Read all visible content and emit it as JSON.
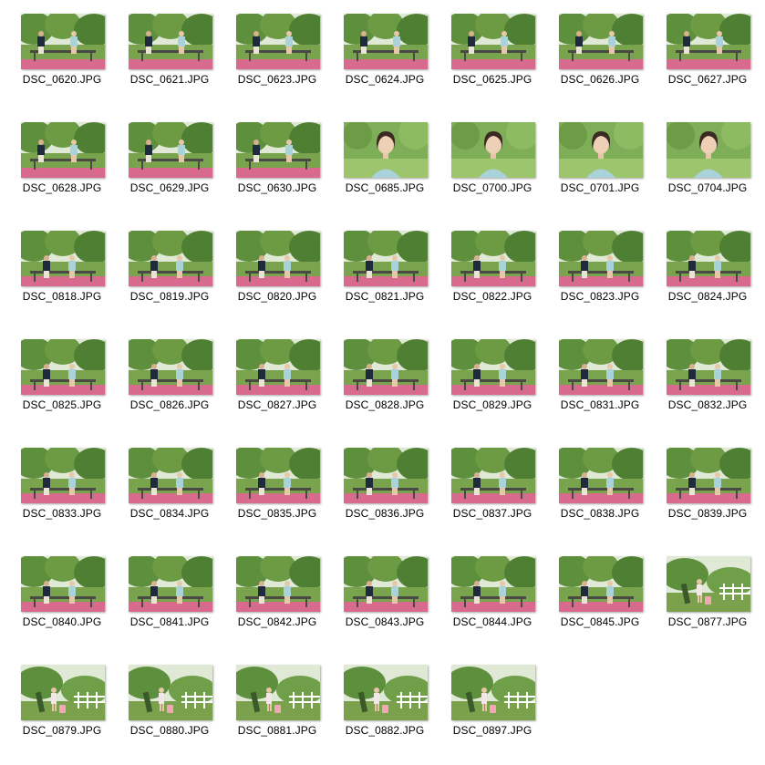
{
  "explorer": {
    "selected_index": 47,
    "files": [
      {
        "name": "DSC_0620.JPG",
        "scene": "couple"
      },
      {
        "name": "DSC_0621.JPG",
        "scene": "couple"
      },
      {
        "name": "DSC_0623.JPG",
        "scene": "couple"
      },
      {
        "name": "DSC_0624.JPG",
        "scene": "couple"
      },
      {
        "name": "DSC_0625.JPG",
        "scene": "couple"
      },
      {
        "name": "DSC_0626.JPG",
        "scene": "couple"
      },
      {
        "name": "DSC_0627.JPG",
        "scene": "couple"
      },
      {
        "name": "DSC_0628.JPG",
        "scene": "couple"
      },
      {
        "name": "DSC_0629.JPG",
        "scene": "couple"
      },
      {
        "name": "DSC_0630.JPG",
        "scene": "couple"
      },
      {
        "name": "DSC_0685.JPG",
        "scene": "portrait"
      },
      {
        "name": "DSC_0700.JPG",
        "scene": "portrait"
      },
      {
        "name": "DSC_0701.JPG",
        "scene": "portrait"
      },
      {
        "name": "DSC_0704.JPG",
        "scene": "portrait"
      },
      {
        "name": "DSC_0818.JPG",
        "scene": "bench"
      },
      {
        "name": "DSC_0819.JPG",
        "scene": "bench"
      },
      {
        "name": "DSC_0820.JPG",
        "scene": "bench"
      },
      {
        "name": "DSC_0821.JPG",
        "scene": "bench"
      },
      {
        "name": "DSC_0822.JPG",
        "scene": "bench"
      },
      {
        "name": "DSC_0823.JPG",
        "scene": "bench"
      },
      {
        "name": "DSC_0824.JPG",
        "scene": "bench"
      },
      {
        "name": "DSC_0825.JPG",
        "scene": "park"
      },
      {
        "name": "DSC_0826.JPG",
        "scene": "park"
      },
      {
        "name": "DSC_0827.JPG",
        "scene": "park"
      },
      {
        "name": "DSC_0828.JPG",
        "scene": "park"
      },
      {
        "name": "DSC_0829.JPG",
        "scene": "park"
      },
      {
        "name": "DSC_0831.JPG",
        "scene": "park"
      },
      {
        "name": "DSC_0832.JPG",
        "scene": "park"
      },
      {
        "name": "DSC_0833.JPG",
        "scene": "park"
      },
      {
        "name": "DSC_0834.JPG",
        "scene": "park"
      },
      {
        "name": "DSC_0835.JPG",
        "scene": "park"
      },
      {
        "name": "DSC_0836.JPG",
        "scene": "park"
      },
      {
        "name": "DSC_0837.JPG",
        "scene": "park"
      },
      {
        "name": "DSC_0838.JPG",
        "scene": "park"
      },
      {
        "name": "DSC_0839.JPG",
        "scene": "park"
      },
      {
        "name": "DSC_0840.JPG",
        "scene": "park"
      },
      {
        "name": "DSC_0841.JPG",
        "scene": "park"
      },
      {
        "name": "DSC_0842.JPG",
        "scene": "park"
      },
      {
        "name": "DSC_0843.JPG",
        "scene": "park"
      },
      {
        "name": "DSC_0844.JPG",
        "scene": "park"
      },
      {
        "name": "DSC_0845.JPG",
        "scene": "park"
      },
      {
        "name": "DSC_0877.JPG",
        "scene": "fence"
      },
      {
        "name": "DSC_0879.JPG",
        "scene": "fence"
      },
      {
        "name": "DSC_0880.JPG",
        "scene": "fence"
      },
      {
        "name": "DSC_0881.JPG",
        "scene": "fence"
      },
      {
        "name": "DSC_0882.JPG",
        "scene": "fence"
      },
      {
        "name": "DSC_0897.JPG",
        "scene": "fence"
      }
    ]
  },
  "colors": {
    "selection_border": "#99d1ff",
    "foliage": "#5e8f3c",
    "sky": "#dfe9d6",
    "flowers": "#d86a8e",
    "bench": "#4a4a45",
    "shirt_light": "#a9d3d8",
    "shirt_dark": "#1f2a3c"
  }
}
